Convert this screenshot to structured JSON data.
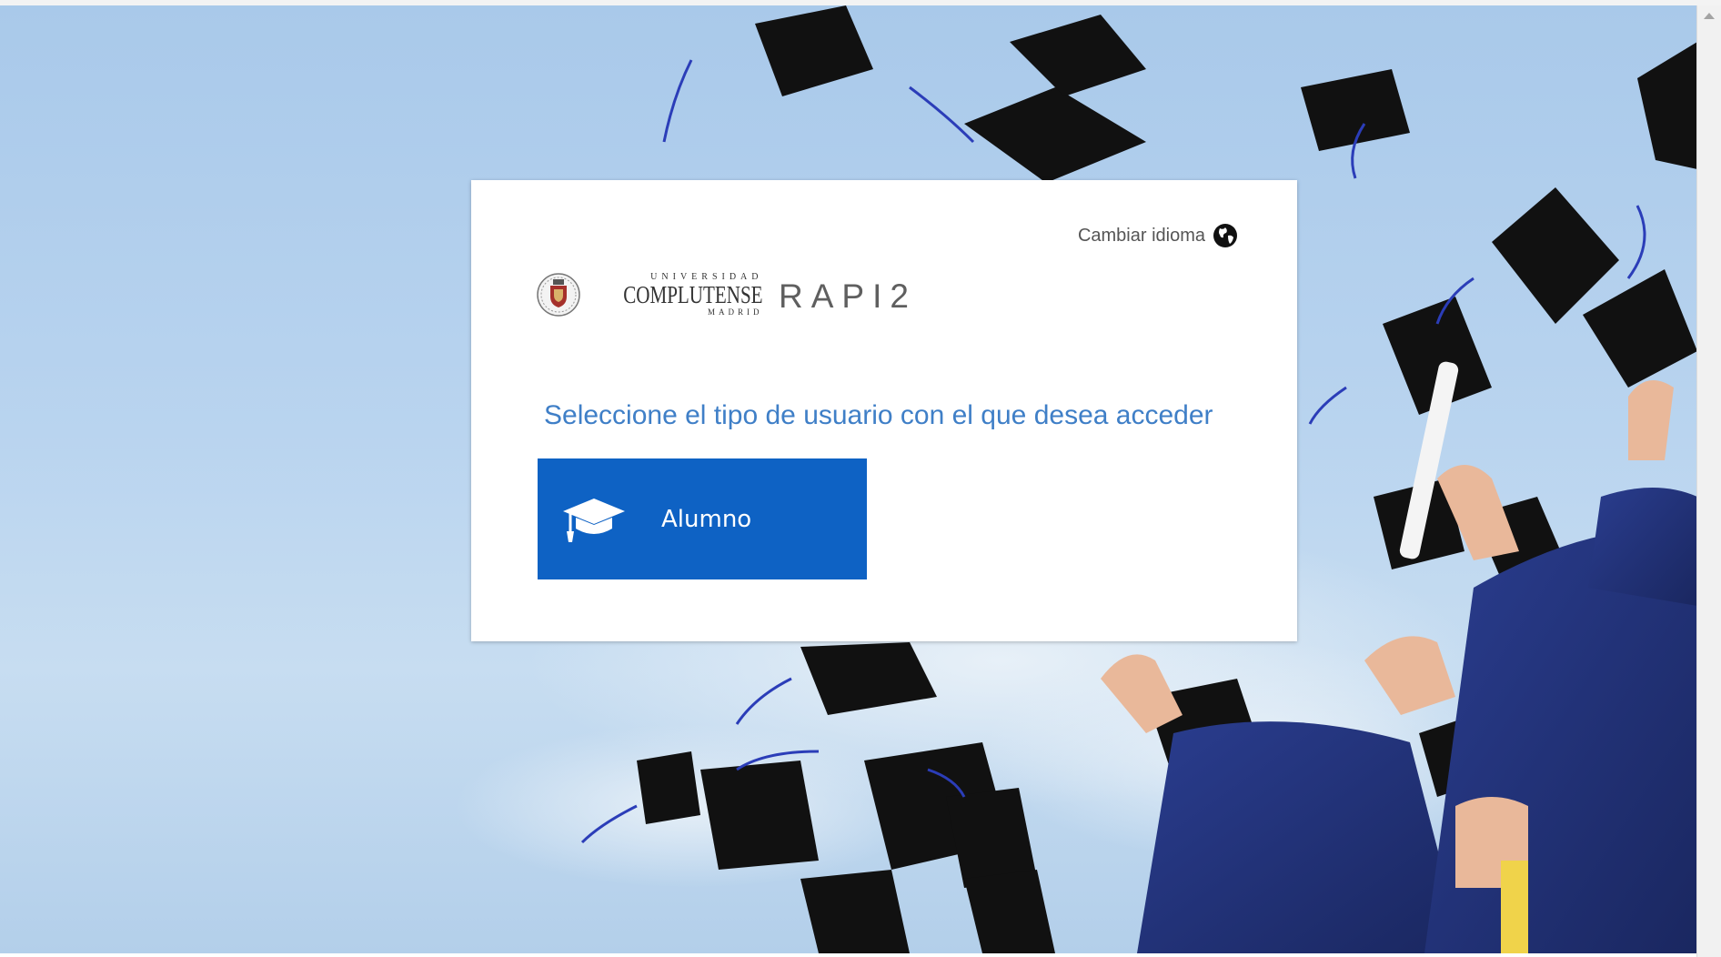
{
  "header": {
    "language_label": "Cambiar idioma",
    "language_icon": "globe-icon"
  },
  "branding": {
    "university_top": "UNIVERSIDAD",
    "university_name": "COMPLUTENSE",
    "university_city": "MADRID",
    "app_name": "RAPI2"
  },
  "main": {
    "prompt": "Seleccione el tipo de usuario con el que desea acceder",
    "roles": [
      {
        "label": "Alumno",
        "icon": "graduation-cap-icon"
      }
    ]
  },
  "colors": {
    "primary_button": "#0e62c4",
    "prompt_text": "#3f7fc7",
    "sky": "#b9d4ef"
  }
}
